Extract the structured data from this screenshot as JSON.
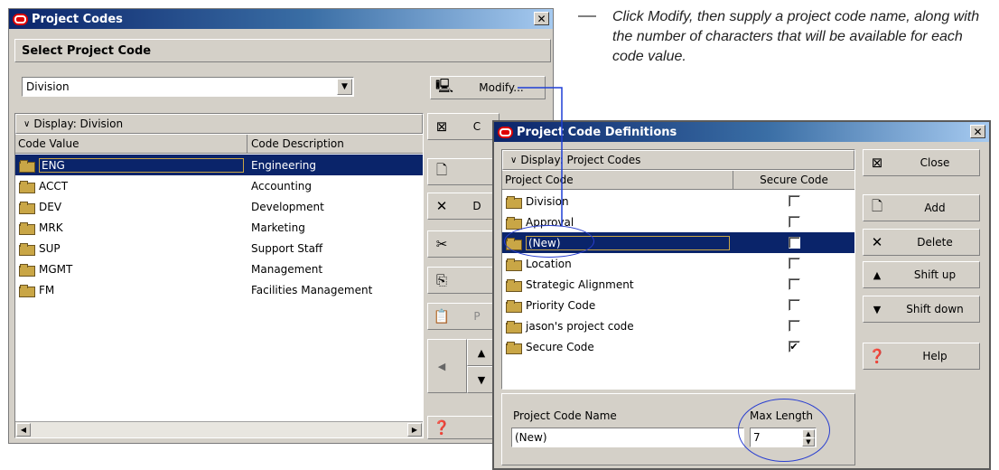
{
  "annotation": "Click Modify, then supply a project code name, along with the number of characters that will be available for each code value.",
  "codes_window": {
    "title": "Project Codes",
    "section_title": "Select Project Code",
    "selected_code": "Division",
    "modify_label": "Modify...",
    "display_label": "Display: Division",
    "columns": [
      "Code Value",
      "Code Description"
    ],
    "rows": [
      {
        "value": "ENG",
        "desc": "Engineering"
      },
      {
        "value": "ACCT",
        "desc": "Accounting"
      },
      {
        "value": "DEV",
        "desc": "Development"
      },
      {
        "value": "MRK",
        "desc": "Marketing"
      },
      {
        "value": "SUP",
        "desc": "Support Staff"
      },
      {
        "value": "MGMT",
        "desc": "Management"
      },
      {
        "value": "FM",
        "desc": "Facilities Management"
      }
    ],
    "side_partial": {
      "close": "C",
      "add": "",
      "delete": "D",
      "paste": "P"
    }
  },
  "defs_window": {
    "title": "Project Code Definitions",
    "display_label": "Display: Project Codes",
    "columns": [
      "Project Code",
      "Secure Code"
    ],
    "rows": [
      {
        "name": "Division",
        "secure": false
      },
      {
        "name": "Approval",
        "secure": false
      },
      {
        "name": "(New)",
        "secure": false
      },
      {
        "name": "Location",
        "secure": false
      },
      {
        "name": "Strategic Alignment",
        "secure": false
      },
      {
        "name": "Priority Code",
        "secure": false
      },
      {
        "name": "jason's project code",
        "secure": false
      },
      {
        "name": "Secure Code",
        "secure": true
      }
    ],
    "buttons": {
      "close": "Close",
      "add": "Add",
      "delete": "Delete",
      "shift_up": "Shift up",
      "shift_down": "Shift down",
      "help": "Help"
    },
    "name_label": "Project Code Name",
    "name_value": "(New)",
    "max_label": "Max Length",
    "max_value": "7"
  }
}
